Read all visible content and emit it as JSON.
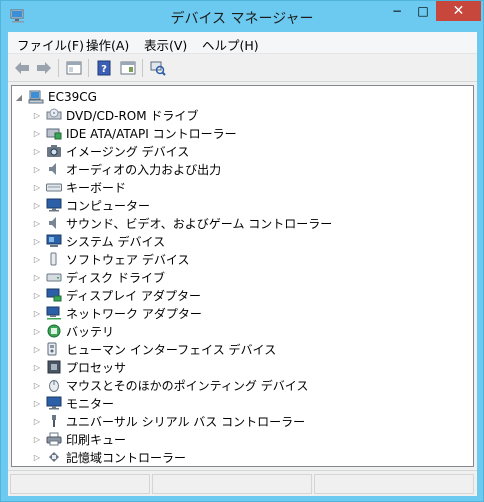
{
  "window": {
    "title": "デバイス マネージャー",
    "icon": "device-manager-icon",
    "controls": {
      "minimize": "−",
      "maximize": "□",
      "close": "✕"
    },
    "accent": "#6ccaf0",
    "close_color": "#c7473c"
  },
  "menubar": {
    "items": [
      {
        "label": "ファイル(F)"
      },
      {
        "label": "操作(A)"
      },
      {
        "label": "表示(V)"
      },
      {
        "label": "ヘルプ(H)"
      }
    ]
  },
  "toolbar": {
    "buttons": [
      {
        "icon": "back-arrow-icon"
      },
      {
        "icon": "forward-arrow-icon"
      },
      {
        "icon": "show-hide-console-tree-icon"
      },
      {
        "icon": "help-icon"
      },
      {
        "icon": "properties-icon"
      },
      {
        "icon": "scan-hardware-changes-icon"
      }
    ]
  },
  "tree": {
    "root": {
      "label": "EC39CG",
      "icon": "computer-icon",
      "expanded": true
    },
    "items": [
      {
        "label": "DVD/CD-ROM ドライブ",
        "icon": "dvd-drive-icon"
      },
      {
        "label": "IDE ATA/ATAPI コントローラー",
        "icon": "ide-controller-icon"
      },
      {
        "label": "イメージング デバイス",
        "icon": "camera-icon"
      },
      {
        "label": "オーディオの入力および出力",
        "icon": "speaker-icon"
      },
      {
        "label": "キーボード",
        "icon": "keyboard-icon"
      },
      {
        "label": "コンピューター",
        "icon": "monitor-icon"
      },
      {
        "label": "サウンド、ビデオ、およびゲーム コントローラー",
        "icon": "speaker-icon"
      },
      {
        "label": "システム デバイス",
        "icon": "system-device-icon"
      },
      {
        "label": "ソフトウェア デバイス",
        "icon": "software-device-icon"
      },
      {
        "label": "ディスク ドライブ",
        "icon": "disk-drive-icon"
      },
      {
        "label": "ディスプレイ アダプター",
        "icon": "display-adapter-icon"
      },
      {
        "label": "ネットワーク アダプター",
        "icon": "network-adapter-icon"
      },
      {
        "label": "バッテリ",
        "icon": "battery-icon"
      },
      {
        "label": "ヒューマン インターフェイス デバイス",
        "icon": "hid-icon"
      },
      {
        "label": "プロセッサ",
        "icon": "processor-icon"
      },
      {
        "label": "マウスとそのほかのポインティング デバイス",
        "icon": "mouse-icon"
      },
      {
        "label": "モニター",
        "icon": "monitor-icon"
      },
      {
        "label": "ユニバーサル シリアル バス コントローラー",
        "icon": "usb-icon"
      },
      {
        "label": "印刷キュー",
        "icon": "printer-icon"
      },
      {
        "label": "記憶域コントローラー",
        "icon": "storage-controller-icon"
      }
    ]
  }
}
